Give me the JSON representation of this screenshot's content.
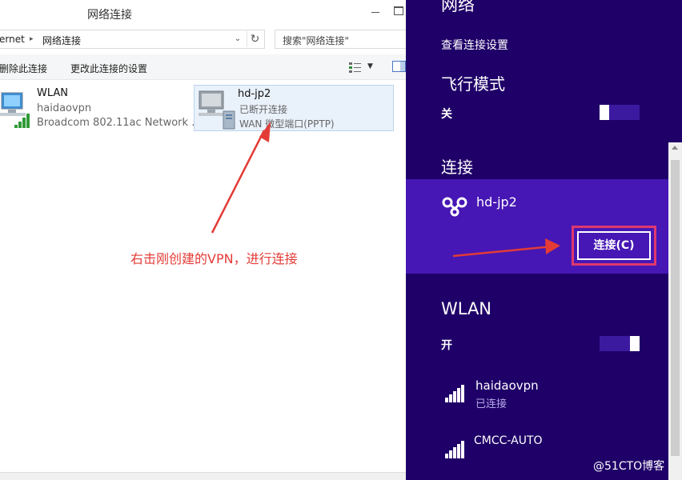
{
  "explorer": {
    "title": "网络连接",
    "address_crumbs": [
      "ernet",
      "▸",
      "网络连接"
    ],
    "search_placeholder": "搜索\"网络连接\"",
    "commands": [
      "删除此连接",
      "更改此连接的设置"
    ],
    "items": [
      {
        "name": "WLAN",
        "status": "haidaovpn",
        "device": "Broadcom 802.11ac Network ..."
      },
      {
        "name": "hd-jp2",
        "status": "已断开连接",
        "device": "WAN 微型端口(PPTP)"
      }
    ]
  },
  "annotation": {
    "text": "右击刚创建的VPN，进行连接",
    "color": "#e33b36"
  },
  "charms": {
    "header": "网络",
    "view_settings": "查看连接设置",
    "airplane": {
      "title": "飞行模式",
      "state_label": "关",
      "on": false
    },
    "connections": {
      "title": "连接",
      "vpn_name": "hd-jp2",
      "connect_button": "连接(C)"
    },
    "wlan": {
      "title": "WLAN",
      "state_label": "开",
      "on": true,
      "networks": [
        {
          "ssid": "haidaovpn",
          "status": "已连接"
        },
        {
          "ssid": "CMCC-AUTO",
          "status": ""
        }
      ]
    },
    "colors": {
      "background": "#1f0068",
      "selected": "#4617b4",
      "highlight": "#e0386e"
    }
  },
  "watermark": "@51CTO博客"
}
